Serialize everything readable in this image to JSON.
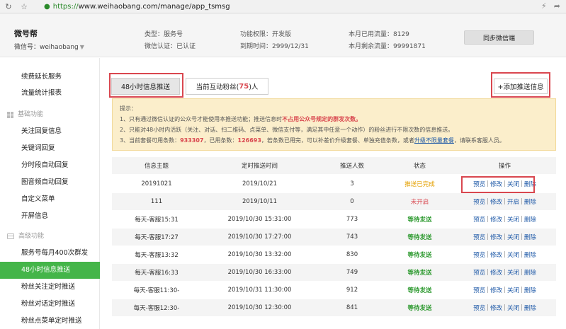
{
  "browser": {
    "url_https": "https://",
    "url_rest": "www.weihaobang.com/manage/app_tsmsg"
  },
  "header": {
    "account_name": "微号帮",
    "account_id": "微信号：weihaobang",
    "type": "类型：服务号",
    "verify": "微信认证：已认证",
    "permission": "功能权限：开发版",
    "expiry": "到期时间：2999/12/31",
    "used_traffic": "本月已用流量：8129",
    "remaining_traffic": "本月剩余流量：99991871",
    "sync_button": "同步微信端"
  },
  "sidebar": {
    "items_top": [
      "续费延长服务",
      "流量统计报表"
    ],
    "group_basic": "基础功能",
    "items_basic": [
      "关注回复信息",
      "关键词回复",
      "分时段自动回复",
      "图音频自动回复",
      "自定义菜单",
      "开屏信息"
    ],
    "group_advanced": "高级功能",
    "items_advanced": [
      "服务号每月400次群发",
      "48小时信息推送",
      "粉丝关注定时推送",
      "粉丝对话定时推送",
      "粉丝点菜单定时推送"
    ]
  },
  "tabs": {
    "active": "48小时信息推送",
    "other_prefix": "当前互动粉丝(",
    "other_num": "75",
    "other_suffix": ")人"
  },
  "add_button": "+添加推送信息",
  "notice": {
    "title": "提示：",
    "line1_a": "1、只有通过微信认证的公众号才能使用本推送功能；推送信息时",
    "line1_b": "不占用公众号规定的群发次数。",
    "line2": "2、只能对48小时内活跃（关注、对话、扫二维码、点菜单、微信支付等，满足其中任意一个动作）的粉丝进行不限次数的信息推送。",
    "line3_a": "3、当前套餐可用条数：",
    "line3_n1": "933307",
    "line3_b": "，已用条数：",
    "line3_n2": "126693",
    "line3_c": "，若条数已用完，可以补差价升级套餐、单独充值条数，或者",
    "line3_link": "升级不限量套餐",
    "line3_d": "，请联系客服人员。"
  },
  "table": {
    "headers": [
      "信息主题",
      "定时推送时间",
      "推送人数",
      "状态",
      "操作"
    ],
    "rows": [
      {
        "subject": "20191021",
        "time": "2019/10/21",
        "count": "3",
        "status": "推送已完成",
        "ops": [
          "预览",
          "修改",
          "关闭",
          "删除"
        ]
      },
      {
        "subject": "111",
        "time": "2019/10/11",
        "count": "0",
        "status": "未开启",
        "ops": [
          "预览",
          "修改",
          "开启",
          "删除"
        ]
      },
      {
        "subject": "每天-客服15:31",
        "time": "2019/10/30 15:31:00",
        "count": "773",
        "status": "等待发送",
        "ops": [
          "预览",
          "修改",
          "关闭",
          "删除"
        ]
      },
      {
        "subject": "每天-客服17:27",
        "time": "2019/10/30 17:27:00",
        "count": "743",
        "status": "等待发送",
        "ops": [
          "预览",
          "修改",
          "关闭",
          "删除"
        ]
      },
      {
        "subject": "每天-客服13:32",
        "time": "2019/10/30 13:32:00",
        "count": "830",
        "status": "等待发送",
        "ops": [
          "预览",
          "修改",
          "关闭",
          "删除"
        ]
      },
      {
        "subject": "每天-客服16:33",
        "time": "2019/10/30 16:33:00",
        "count": "749",
        "status": "等待发送",
        "ops": [
          "预览",
          "修改",
          "关闭",
          "删除"
        ]
      },
      {
        "subject": "每天-客服11:30-",
        "time": "2019/10/31 11:30:00",
        "count": "912",
        "status": "等待发送",
        "ops": [
          "预览",
          "修改",
          "关闭",
          "删除"
        ]
      },
      {
        "subject": "每天-客服12:30-",
        "time": "2019/10/30 12:30:00",
        "count": "841",
        "status": "等待发送",
        "ops": [
          "预览",
          "修改",
          "关闭",
          "删除"
        ]
      }
    ]
  },
  "colors": {
    "accent_green": "#44b549",
    "highlight_red": "#d9474f",
    "link_blue": "#1a56a6",
    "notice_bg": "#fbeecb"
  }
}
